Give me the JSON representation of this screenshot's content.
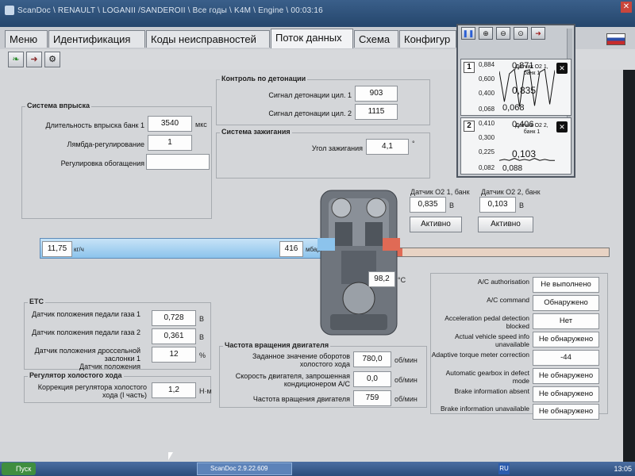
{
  "window": {
    "title": "ScanDoc \\ RENAULT \\ LOGANII /SANDEROII \\ Все годы \\ K4M \\ Engine \\ 00:03:16"
  },
  "tabs": [
    "Меню",
    "Идентификация",
    "Коды неисправностей",
    "Поток данных",
    "Схема",
    "Конфигур"
  ],
  "active_tab": "Поток данных",
  "toolbar": {
    "icons": [
      "leaf-icon",
      "arrow-right-icon",
      "engine-icon"
    ]
  },
  "injection": {
    "title": "Система впрыска",
    "rows": [
      {
        "label": "Длительность впрыска банк 1",
        "value": "3540",
        "unit": "мкс"
      },
      {
        "label": "Лямбда-регулирование",
        "value": "1",
        "unit": ""
      },
      {
        "label": "Регулировка обогащения",
        "value": "",
        "unit": ""
      }
    ]
  },
  "knock": {
    "title": "Контроль по детонации",
    "rows": [
      {
        "label": "Сигнал детонации цил. 1",
        "value": "903"
      },
      {
        "label": "Сигнал детонации цил. 2",
        "value": "1115"
      }
    ]
  },
  "ignition": {
    "title": "Система зажигания",
    "label": "Угол зажигания",
    "value": "4,1",
    "unit": "°"
  },
  "o2": [
    {
      "label": "Датчик О2 1, банк",
      "value": "0,835",
      "unit": "В",
      "button": "Активно"
    },
    {
      "label": "Датчик О2 2, банк",
      "value": "0,103",
      "unit": "В",
      "button": "Активно"
    }
  ],
  "intake": {
    "airflow": "11,75",
    "airflow_unit": "кг/ч",
    "pressure": "416",
    "pressure_unit": "мбар"
  },
  "coolant": {
    "value": "98,2",
    "unit": "°C"
  },
  "etc": {
    "title": "ETC",
    "rows": [
      {
        "label": "Датчик положения педали газа 1",
        "value": "0,728",
        "unit": "В"
      },
      {
        "label": "Датчик положения педали газа 2",
        "value": "0,361",
        "unit": "В"
      },
      {
        "label": "Датчик положения дроссельной заслонки 1",
        "value": "12",
        "unit": "%"
      },
      {
        "label": "Датчик положения",
        "value": "",
        "unit": ""
      }
    ]
  },
  "idle": {
    "title": "Регулятор холостого хода",
    "label": "Коррекция регулятора холостого хода (I часть)",
    "value": "1,2",
    "unit": "Н·м"
  },
  "rpm": {
    "title": "Частота вращения двигателя",
    "rows": [
      {
        "label": "Заданное значение оборотов холостого хода",
        "value": "780,0",
        "unit": "об/мин"
      },
      {
        "label": "Скорость двигателя, запрошенная кондиционером A/C",
        "value": "0,0",
        "unit": "об/мин"
      },
      {
        "label": "Частота вращения двигателя",
        "value": "759",
        "unit": "об/мин"
      }
    ]
  },
  "status": [
    {
      "label": "A/C authorisation",
      "value": "Не выполнено"
    },
    {
      "label": "A/C command",
      "value": "Обнаружено"
    },
    {
      "label": "Acceleration pedal detection blocked",
      "value": "Нет"
    },
    {
      "label": "Actual vehicle speed info unavailable",
      "value": "Не обнаружено"
    },
    {
      "label": "Adaptive torque meter correction",
      "value": "-44"
    },
    {
      "label": "Automatic gearbox in defect mode",
      "value": "Не обнаружено"
    },
    {
      "label": "Brake information absent",
      "value": "Не обнаружено"
    },
    {
      "label": "Brake information unavailable",
      "value": "Не обнаружено"
    }
  ],
  "graphs": [
    {
      "index": "1",
      "ticks": [
        "0,884",
        "0,600",
        "0,400",
        "0,068"
      ],
      "name": "Датчик О2 1, банк 1",
      "current": "0,835",
      "value_overlay": "0,871",
      "bottom": "0,068",
      "series": [
        0.8,
        0.2,
        0.75,
        0.84,
        0.1,
        0.8,
        0.83,
        0.12,
        0.78,
        0.84,
        0.15,
        0.82
      ]
    },
    {
      "index": "2",
      "ticks": [
        "0,410",
        "0,300",
        "0,225",
        "0,082"
      ],
      "name": "Датчик О2 2, банк 1",
      "current": "0,103",
      "value_overlay": "0,406",
      "bottom": "0,088",
      "series": [
        0.1,
        0.11,
        0.1,
        0.12,
        0.1,
        0.11,
        0.1,
        0.12,
        0.1,
        0.11,
        0.1,
        0.1
      ]
    }
  ],
  "graph_toolbar": [
    "pause-icon",
    "zoom-in-icon",
    "zoom-out-icon",
    "zoom-fit-icon",
    "forward-icon"
  ],
  "taskbar": {
    "start": "Пуск",
    "task": "ScanDoc 2.9.22.609",
    "lang": "RU",
    "clock": "13:05"
  },
  "colors": {
    "intake_blue": "#8cc3ec",
    "exhaust_red": "#e06a55"
  }
}
